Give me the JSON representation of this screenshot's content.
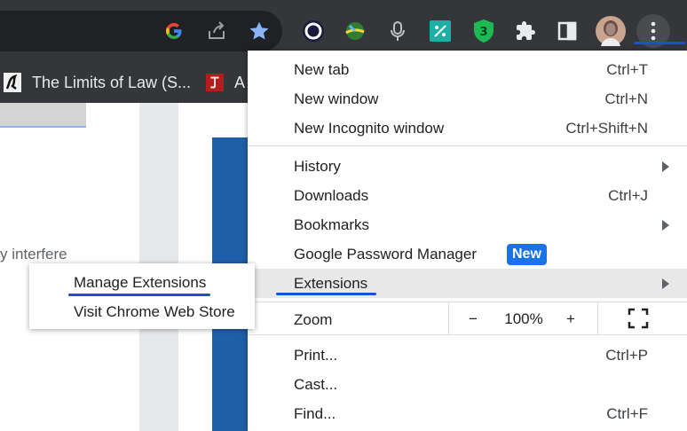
{
  "toolbar": {
    "icons": [
      "google-icon",
      "share-icon",
      "bookmark-star-icon",
      "extension-circle-icon",
      "extension-globe-icon",
      "microphone-icon",
      "extension-teal-icon",
      "extension-green-shield-icon",
      "puzzle-icon",
      "side-panel-icon",
      "avatar",
      "kebab-menu-icon"
    ],
    "colors": {
      "bg": "#35363a",
      "star": "#8ab4f8",
      "underline": "#1a4fd6"
    }
  },
  "bookmarks": {
    "items": [
      {
        "label": "The Limits of Law (S..."
      },
      {
        "label": "A"
      }
    ]
  },
  "page": {
    "partial_text": "y interfere"
  },
  "menu": {
    "new_tab": {
      "label": "New tab",
      "shortcut": "Ctrl+T"
    },
    "new_window": {
      "label": "New window",
      "shortcut": "Ctrl+N"
    },
    "new_incognito": {
      "label": "New Incognito window",
      "shortcut": "Ctrl+Shift+N"
    },
    "history": {
      "label": "History"
    },
    "downloads": {
      "label": "Downloads",
      "shortcut": "Ctrl+J"
    },
    "bookmarks": {
      "label": "Bookmarks"
    },
    "password_manager": {
      "label": "Google Password Manager",
      "badge": "New"
    },
    "extensions": {
      "label": "Extensions"
    },
    "zoom": {
      "label": "Zoom",
      "minus": "−",
      "level": "100%",
      "plus": "+"
    },
    "print": {
      "label": "Print...",
      "shortcut": "Ctrl+P"
    },
    "cast": {
      "label": "Cast..."
    },
    "find": {
      "label": "Find...",
      "shortcut": "Ctrl+F"
    }
  },
  "submenu": {
    "manage_extensions": "Manage Extensions",
    "visit_store": "Visit Chrome Web Store"
  }
}
